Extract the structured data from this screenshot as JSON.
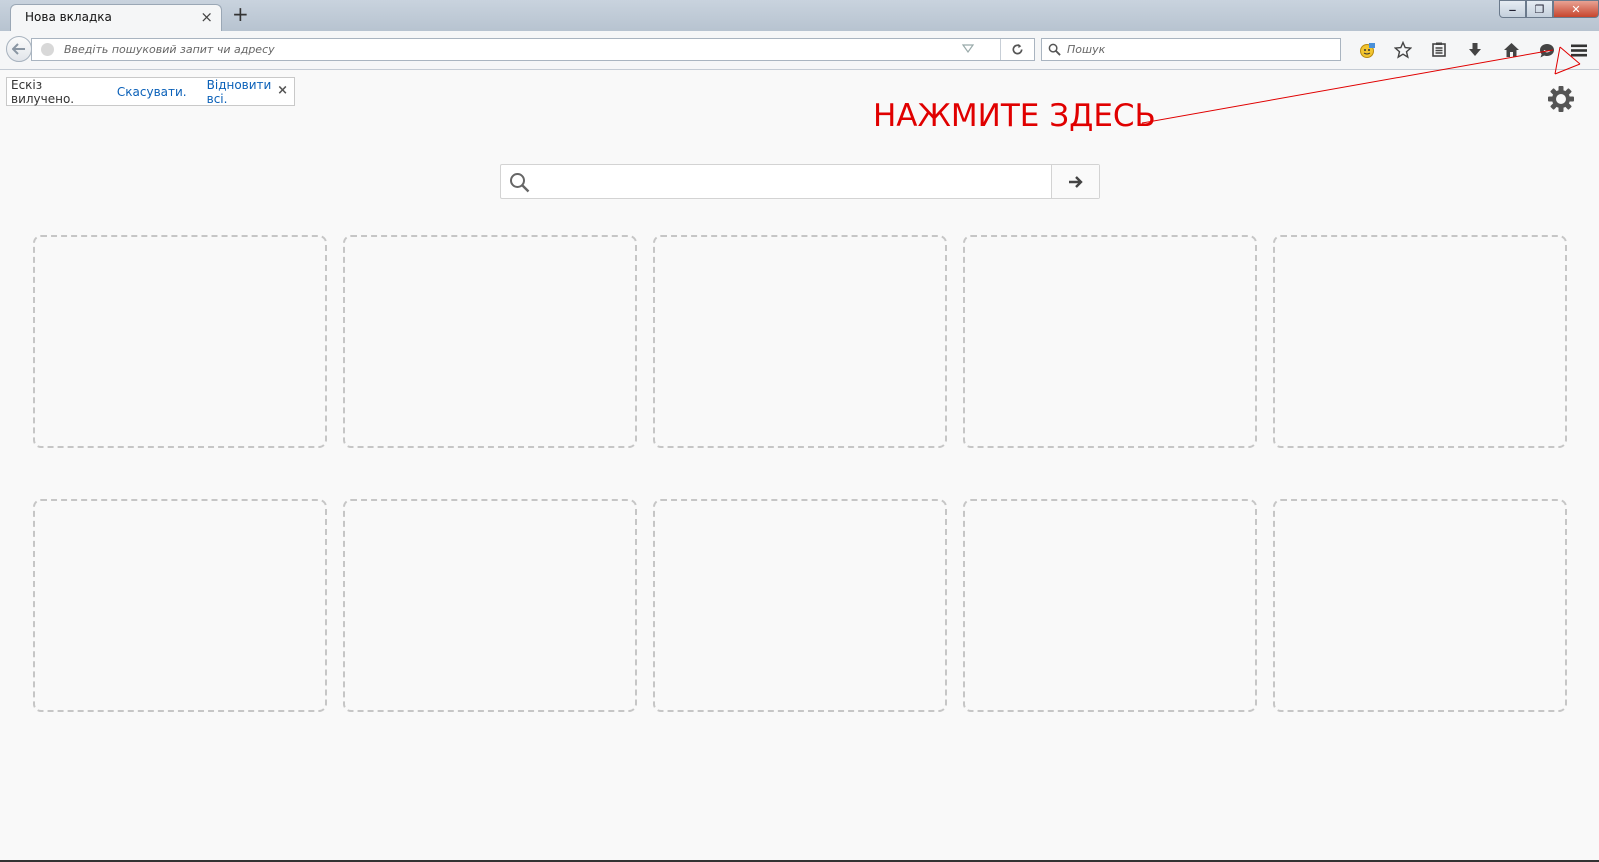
{
  "tab": {
    "title": "Нова вкладка",
    "close_glyph": "×"
  },
  "new_tab_glyph": "+",
  "window_controls": {
    "minimize": "–",
    "maximize": "❐",
    "close": "✕"
  },
  "urlbar": {
    "placeholder": "Введіть пошуковий запит чи адресу"
  },
  "searchbar": {
    "placeholder": "Пошук"
  },
  "notice": {
    "text": "Ескіз вилучено.",
    "undo": "Скасувати.",
    "restore": "Відновити всі.",
    "close": "×"
  },
  "annotation": {
    "text": "НАЖМИТЕ ЗДЕСЬ",
    "color": "#e00000"
  },
  "tiles": {
    "count": 10
  },
  "colors": {
    "link": "#0a60b8",
    "tile_border": "#c6c6c6"
  }
}
